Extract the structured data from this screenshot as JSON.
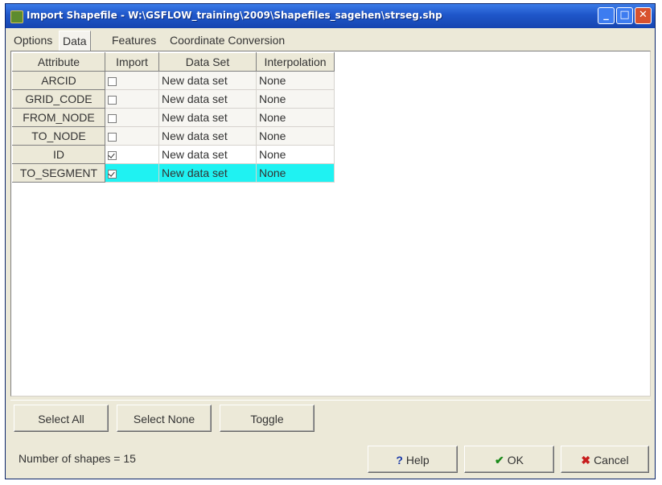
{
  "window": {
    "title": "Import Shapefile - W:\\GSFLOW_training\\2009\\Shapefiles_sagehen\\strseg.shp",
    "minimize_glyph": "_",
    "maximize_glyph": "□",
    "close_glyph": "✕"
  },
  "tabs": [
    {
      "label": "Options"
    },
    {
      "label": "Data"
    },
    {
      "label": "Features"
    },
    {
      "label": "Coordinate Conversion"
    }
  ],
  "active_tab": "Data",
  "grid": {
    "headers": [
      "Attribute",
      "Import",
      "Data Set",
      "Interpolation"
    ],
    "rows": [
      {
        "attribute": "ARCID",
        "import": false,
        "data_set": "New data set",
        "interpolation": "None"
      },
      {
        "attribute": "GRID_CODE",
        "import": false,
        "data_set": "New data set",
        "interpolation": "None"
      },
      {
        "attribute": "FROM_NODE",
        "import": false,
        "data_set": "New data set",
        "interpolation": "None"
      },
      {
        "attribute": "TO_NODE",
        "import": false,
        "data_set": "New data set",
        "interpolation": "None"
      },
      {
        "attribute": "ID",
        "import": true,
        "data_set": "New data set",
        "interpolation": "None"
      },
      {
        "attribute": "TO_SEGMENT",
        "import": true,
        "data_set": "New data set",
        "interpolation": "None"
      }
    ],
    "selected_row": 5,
    "selected_color": "#1ff2f2"
  },
  "buttons": {
    "select_all": "Select All",
    "select_none": "Select None",
    "toggle": "Toggle"
  },
  "status": {
    "shape_count": "Number of shapes = 15"
  },
  "dialog_buttons": {
    "help": "Help",
    "ok": "OK",
    "cancel": "Cancel"
  }
}
